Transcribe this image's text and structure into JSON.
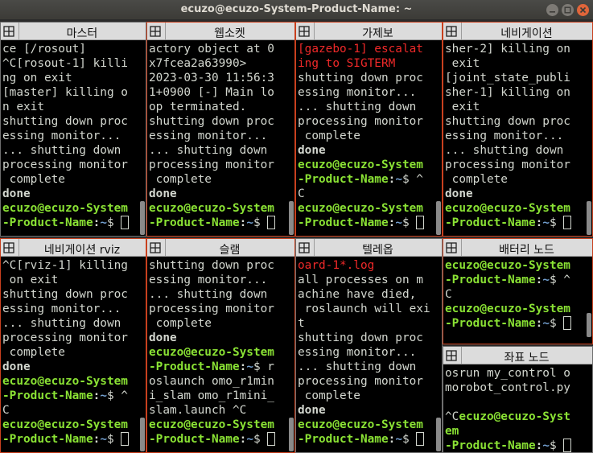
{
  "window": {
    "title": "ecuzo@ecuzo-System-Product-Name: ~"
  },
  "panes": [
    {
      "title": "마스터",
      "lines": [
        [
          {
            "t": "ce [/rosout]"
          }
        ],
        [
          {
            "t": "^C[rosout-1] killi"
          }
        ],
        [
          {
            "t": "ng on exit"
          }
        ],
        [
          {
            "t": "[master] killing o"
          }
        ],
        [
          {
            "t": "n exit"
          }
        ],
        [
          {
            "t": "shutting down proc"
          }
        ],
        [
          {
            "t": "essing monitor..."
          }
        ],
        [
          {
            "t": "... shutting down"
          }
        ],
        [
          {
            "t": "processing monitor"
          }
        ],
        [
          {
            "t": " complete"
          }
        ],
        [
          {
            "t": "done",
            "c": "b"
          }
        ],
        [
          {
            "t": "ecuzo@ecuzo-System",
            "c": "g"
          }
        ],
        [
          {
            "t": "-Product-Name",
            "c": "g"
          },
          {
            "t": ":",
            "c": "b"
          },
          {
            "t": "~",
            "c": "bl"
          },
          {
            "t": "$ "
          },
          {
            "cursor": true
          }
        ]
      ]
    },
    {
      "title": "웹소켓",
      "lines": [
        [
          {
            "t": "actory object at 0"
          }
        ],
        [
          {
            "t": "x7fcea2a63990>"
          }
        ],
        [
          {
            "t": "2023-03-30 11:56:3"
          }
        ],
        [
          {
            "t": "1+0900 [-] Main lo"
          }
        ],
        [
          {
            "t": "op terminated."
          }
        ],
        [
          {
            "t": "shutting down proc"
          }
        ],
        [
          {
            "t": "essing monitor..."
          }
        ],
        [
          {
            "t": "... shutting down"
          }
        ],
        [
          {
            "t": "processing monitor"
          }
        ],
        [
          {
            "t": " complete"
          }
        ],
        [
          {
            "t": "done",
            "c": "b"
          }
        ],
        [
          {
            "t": "ecuzo@ecuzo-System",
            "c": "g"
          }
        ],
        [
          {
            "t": "-Product-Name",
            "c": "g"
          },
          {
            "t": ":",
            "c": "b"
          },
          {
            "t": "~",
            "c": "bl"
          },
          {
            "t": "$ "
          },
          {
            "cursor": true
          }
        ]
      ]
    },
    {
      "title": "가제보",
      "lines": [
        [
          {
            "t": "[gazebo-1] escalat",
            "c": "r"
          }
        ],
        [
          {
            "t": "ing to SIGTERM",
            "c": "r"
          }
        ],
        [
          {
            "t": "shutting down proc"
          }
        ],
        [
          {
            "t": "essing monitor..."
          }
        ],
        [
          {
            "t": "... shutting down"
          }
        ],
        [
          {
            "t": "processing monitor"
          }
        ],
        [
          {
            "t": " complete"
          }
        ],
        [
          {
            "t": "done",
            "c": "b"
          }
        ],
        [
          {
            "t": "ecuzo@ecuzo-System",
            "c": "g"
          }
        ],
        [
          {
            "t": "-Product-Name",
            "c": "g"
          },
          {
            "t": ":",
            "c": "b"
          },
          {
            "t": "~",
            "c": "bl"
          },
          {
            "t": "$ ^"
          }
        ],
        [
          {
            "t": "C"
          }
        ],
        [
          {
            "t": "ecuzo@ecuzo-System",
            "c": "g"
          }
        ],
        [
          {
            "t": "-Product-Name",
            "c": "g"
          },
          {
            "t": ":",
            "c": "b"
          },
          {
            "t": "~",
            "c": "bl"
          },
          {
            "t": "$ "
          },
          {
            "cursor": true
          }
        ]
      ]
    },
    {
      "title": "네비게이션",
      "lines": [
        [
          {
            "t": "sher-2] killing on"
          }
        ],
        [
          {
            "t": " exit"
          }
        ],
        [
          {
            "t": "[joint_state_publi"
          }
        ],
        [
          {
            "t": "sher-1] killing on"
          }
        ],
        [
          {
            "t": " exit"
          }
        ],
        [
          {
            "t": "shutting down proc"
          }
        ],
        [
          {
            "t": "essing monitor..."
          }
        ],
        [
          {
            "t": "... shutting down"
          }
        ],
        [
          {
            "t": "processing monitor"
          }
        ],
        [
          {
            "t": " complete"
          }
        ],
        [
          {
            "t": "done",
            "c": "b"
          }
        ],
        [
          {
            "t": "ecuzo@ecuzo-System",
            "c": "g"
          }
        ],
        [
          {
            "t": "-Product-Name",
            "c": "g"
          },
          {
            "t": ":",
            "c": "b"
          },
          {
            "t": "~",
            "c": "bl"
          },
          {
            "t": "$ "
          },
          {
            "cursor": true
          }
        ]
      ]
    },
    {
      "title": "네비게이션 rviz",
      "lines": [
        [
          {
            "t": "^C[rviz-1] killing"
          }
        ],
        [
          {
            "t": " on exit"
          }
        ],
        [
          {
            "t": "shutting down proc"
          }
        ],
        [
          {
            "t": "essing monitor..."
          }
        ],
        [
          {
            "t": "... shutting down"
          }
        ],
        [
          {
            "t": "processing monitor"
          }
        ],
        [
          {
            "t": " complete"
          }
        ],
        [
          {
            "t": "done",
            "c": "b"
          }
        ],
        [
          {
            "t": "ecuzo@ecuzo-System",
            "c": "g"
          }
        ],
        [
          {
            "t": "-Product-Name",
            "c": "g"
          },
          {
            "t": ":",
            "c": "b"
          },
          {
            "t": "~",
            "c": "bl"
          },
          {
            "t": "$ ^"
          }
        ],
        [
          {
            "t": "C"
          }
        ],
        [
          {
            "t": "ecuzo@ecuzo-System",
            "c": "g"
          }
        ],
        [
          {
            "t": "-Product-Name",
            "c": "g"
          },
          {
            "t": ":",
            "c": "b"
          },
          {
            "t": "~",
            "c": "bl"
          },
          {
            "t": "$ "
          },
          {
            "cursor": true
          }
        ]
      ]
    },
    {
      "title": "슬램",
      "lines": [
        [
          {
            "t": "shutting down proc"
          }
        ],
        [
          {
            "t": "essing monitor..."
          }
        ],
        [
          {
            "t": "... shutting down"
          }
        ],
        [
          {
            "t": "processing monitor"
          }
        ],
        [
          {
            "t": " complete"
          }
        ],
        [
          {
            "t": "done",
            "c": "b"
          }
        ],
        [
          {
            "t": "ecuzo@ecuzo-System",
            "c": "g"
          }
        ],
        [
          {
            "t": "-Product-Name",
            "c": "g"
          },
          {
            "t": ":",
            "c": "b"
          },
          {
            "t": "~",
            "c": "bl"
          },
          {
            "t": "$ r"
          }
        ],
        [
          {
            "t": "oslaunch omo_r1min"
          }
        ],
        [
          {
            "t": "i_slam omo_r1mini_"
          }
        ],
        [
          {
            "t": "slam.launch ^C"
          }
        ],
        [
          {
            "t": "ecuzo@ecuzo-System",
            "c": "g"
          }
        ],
        [
          {
            "t": "-Product-Name",
            "c": "g"
          },
          {
            "t": ":",
            "c": "b"
          },
          {
            "t": "~",
            "c": "bl"
          },
          {
            "t": "$ "
          },
          {
            "cursor": true
          }
        ]
      ]
    },
    {
      "title": "텔레옵",
      "lines": [
        [
          {
            "t": "oard-1*.log",
            "c": "r"
          }
        ],
        [
          {
            "t": "all processes on m"
          }
        ],
        [
          {
            "t": "achine have died,"
          }
        ],
        [
          {
            "t": " roslaunch will exi"
          }
        ],
        [
          {
            "t": "t"
          }
        ],
        [
          {
            "t": "shutting down proc"
          }
        ],
        [
          {
            "t": "essing monitor..."
          }
        ],
        [
          {
            "t": "... shutting down"
          }
        ],
        [
          {
            "t": "processing monitor"
          }
        ],
        [
          {
            "t": " complete"
          }
        ],
        [
          {
            "t": "done",
            "c": "b"
          }
        ],
        [
          {
            "t": "ecuzo@ecuzo-System",
            "c": "g"
          }
        ],
        [
          {
            "t": "-Product-Name",
            "c": "g"
          },
          {
            "t": ":",
            "c": "b"
          },
          {
            "t": "~",
            "c": "bl"
          },
          {
            "t": "$ "
          },
          {
            "cursor": true
          }
        ]
      ]
    },
    {
      "title": "배터리 노드",
      "lines": [
        [
          {
            "t": "ecuzo@ecuzo-System",
            "c": "g"
          }
        ],
        [
          {
            "t": "-Product-Name",
            "c": "g"
          },
          {
            "t": ":",
            "c": "b"
          },
          {
            "t": "~",
            "c": "bl"
          },
          {
            "t": "$ ^"
          }
        ],
        [
          {
            "t": "C"
          }
        ],
        [
          {
            "t": "ecuzo@ecuzo-System",
            "c": "g"
          }
        ],
        [
          {
            "t": "-Product-Name",
            "c": "g"
          },
          {
            "t": ":",
            "c": "b"
          },
          {
            "t": "~",
            "c": "bl"
          },
          {
            "t": "$ "
          },
          {
            "cursor": true
          }
        ]
      ]
    },
    {
      "title": "좌표 노드",
      "lines": [
        [
          {
            "t": "osrun my_control o"
          }
        ],
        [
          {
            "t": "morobot_control.py"
          }
        ],
        [
          {
            "t": ""
          }
        ],
        [
          {
            "t": "^C"
          },
          {
            "t": "ecuzo@ecuzo-Syst",
            "c": "g"
          }
        ],
        [
          {
            "t": "em",
            "c": "g"
          }
        ],
        [
          {
            "t": "-Product-Name",
            "c": "g"
          },
          {
            "t": ":",
            "c": "b"
          },
          {
            "t": "~",
            "c": "bl"
          },
          {
            "t": "$ "
          },
          {
            "cursor": true
          }
        ]
      ]
    }
  ],
  "colors": {
    "prompt": "#8ae234",
    "path": "#729fcf",
    "error": "#ef2929",
    "text": "#d3d7cf",
    "focused_border": "#c8401e"
  },
  "icons": [
    "split-layout-icon",
    "minimize-icon",
    "maximize-icon",
    "close-icon"
  ]
}
